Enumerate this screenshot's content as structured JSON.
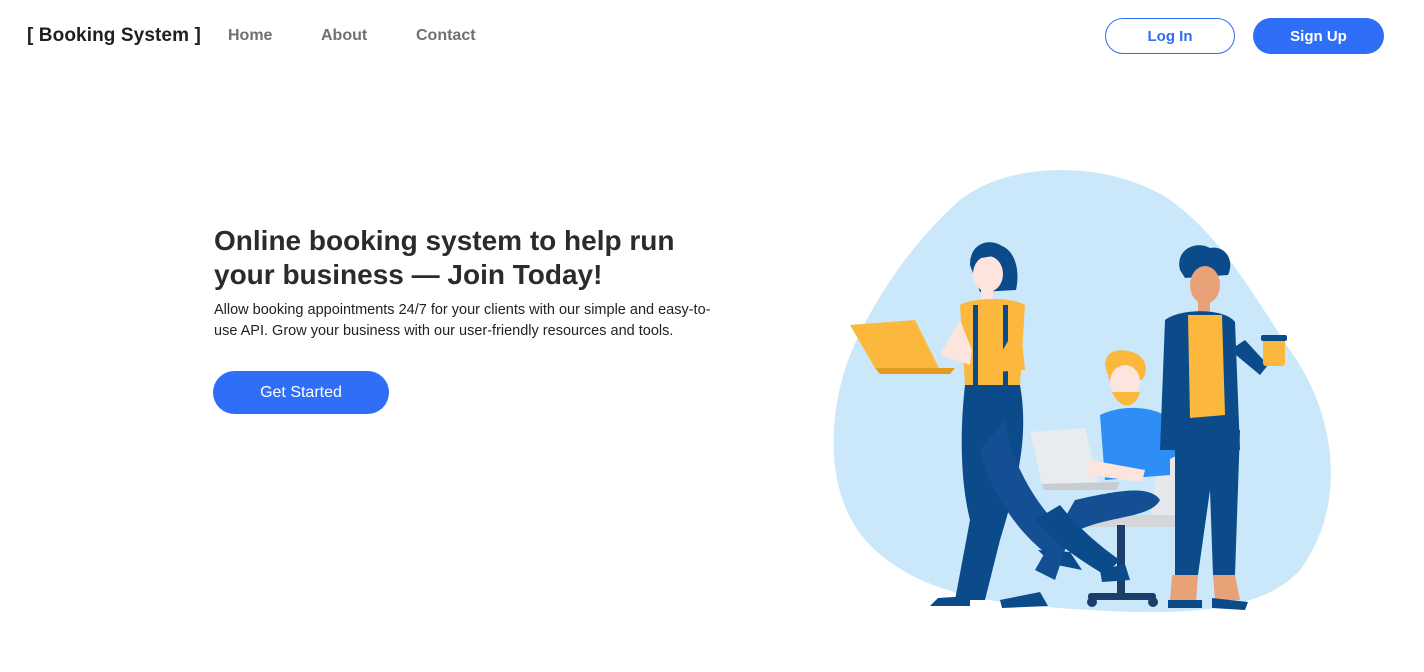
{
  "nav": {
    "brand": "[ Booking System ]",
    "links": [
      "Home",
      "About",
      "Contact"
    ],
    "login_label": "Log In",
    "signup_label": "Sign Up"
  },
  "hero": {
    "title": "Online booking system to help run your business — Join Today!",
    "subtitle": "Allow booking appointments 24/7 for your clients with our simple and easy-to-use API. Grow your business with our user-friendly resources and tools.",
    "cta_label": "Get Started"
  },
  "illustration": {
    "icon": "team-working-illustration"
  },
  "colors": {
    "accent": "#2f6ef6",
    "blob": "#cbe8fb",
    "yellow": "#fbb83c",
    "navy": "#0b4b8a"
  }
}
